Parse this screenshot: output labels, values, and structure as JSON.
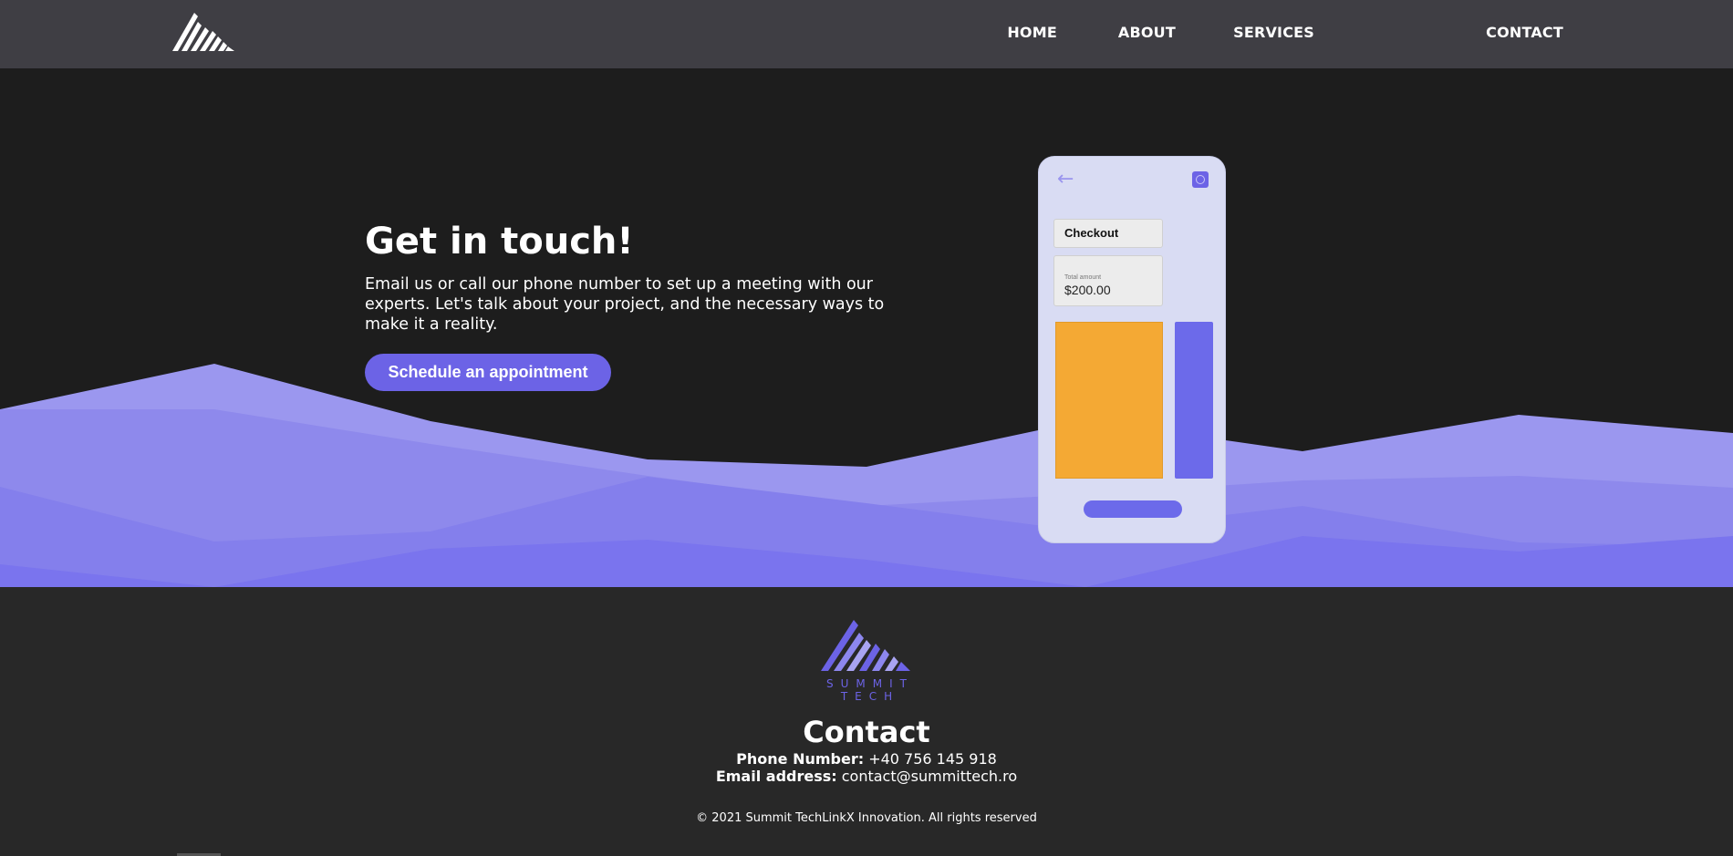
{
  "nav": {
    "logo_icon": "mountain-logo-icon",
    "links": [
      {
        "label": "HOME"
      },
      {
        "label": "ABOUT"
      },
      {
        "label": "SERVICES"
      },
      {
        "label": "CONTACT"
      }
    ]
  },
  "hero": {
    "title": "Get in touch!",
    "description": "Email us or call our phone number to set up a meeting with our experts. Let's talk about your project, and the necessary ways to make it a reality.",
    "cta_label": "Schedule an appointment"
  },
  "phone": {
    "back_icon": "arrow-left-icon",
    "profile_icon": "profile-icon",
    "checkout_label": "Checkout",
    "amount_label": "Total amount",
    "amount_value": "$200.00"
  },
  "footer": {
    "logo_icon": "summit-tech-logo-icon",
    "brand_line_1": "SUMMIT",
    "brand_line_2": "TECH",
    "contact_title": "Contact",
    "phone_label": "Phone Number:",
    "phone_value": "+40 756 145 918",
    "email_label": "Email address:",
    "email_value": "contact@summittech.ro",
    "copyright": "© 2021 Summit TechLinkX Innovation. All rights reserved"
  },
  "colors": {
    "accent": "#6c63e6",
    "navbar_bg": "#3f3e44",
    "hero_bg": "#1d1d1d",
    "footer_bg": "#282828",
    "orange": "#f4a934"
  }
}
